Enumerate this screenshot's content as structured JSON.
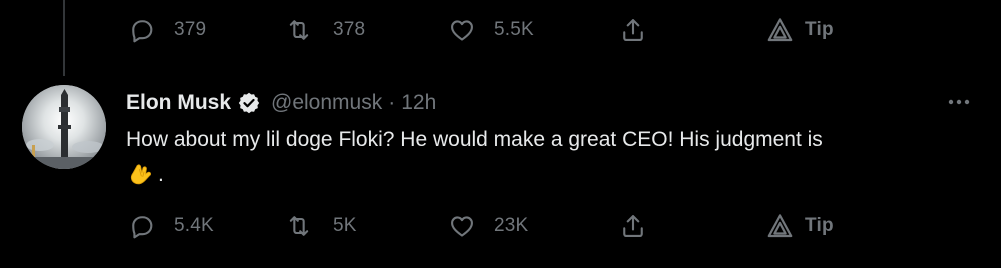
{
  "top_actions": {
    "reply_count": "379",
    "retweet_count": "378",
    "like_count": "5.5K",
    "tip_label": "Tip"
  },
  "tweet": {
    "author_name": "Elon Musk",
    "handle": "@elonmusk",
    "separator": "·",
    "time": "12h",
    "text": "How about my lil doge Floki? He would make a great CEO! His judgment is",
    "emoji": "pinched-fingers-emoji",
    "text_end": ".",
    "verified": true
  },
  "bottom_actions": {
    "reply_count": "5.4K",
    "retweet_count": "5K",
    "like_count": "23K",
    "tip_label": "Tip"
  },
  "icons": {
    "reply": "reply-icon",
    "retweet": "retweet-icon",
    "like": "heart-icon",
    "share": "share-icon",
    "tip": "tip-icon",
    "verified": "verified-badge-icon",
    "more": "more-icon"
  },
  "colors": {
    "background": "#000000",
    "primary_text": "#e7e9ea",
    "secondary_text": "#71767b",
    "emoji_yellow": "#fcc21b"
  }
}
